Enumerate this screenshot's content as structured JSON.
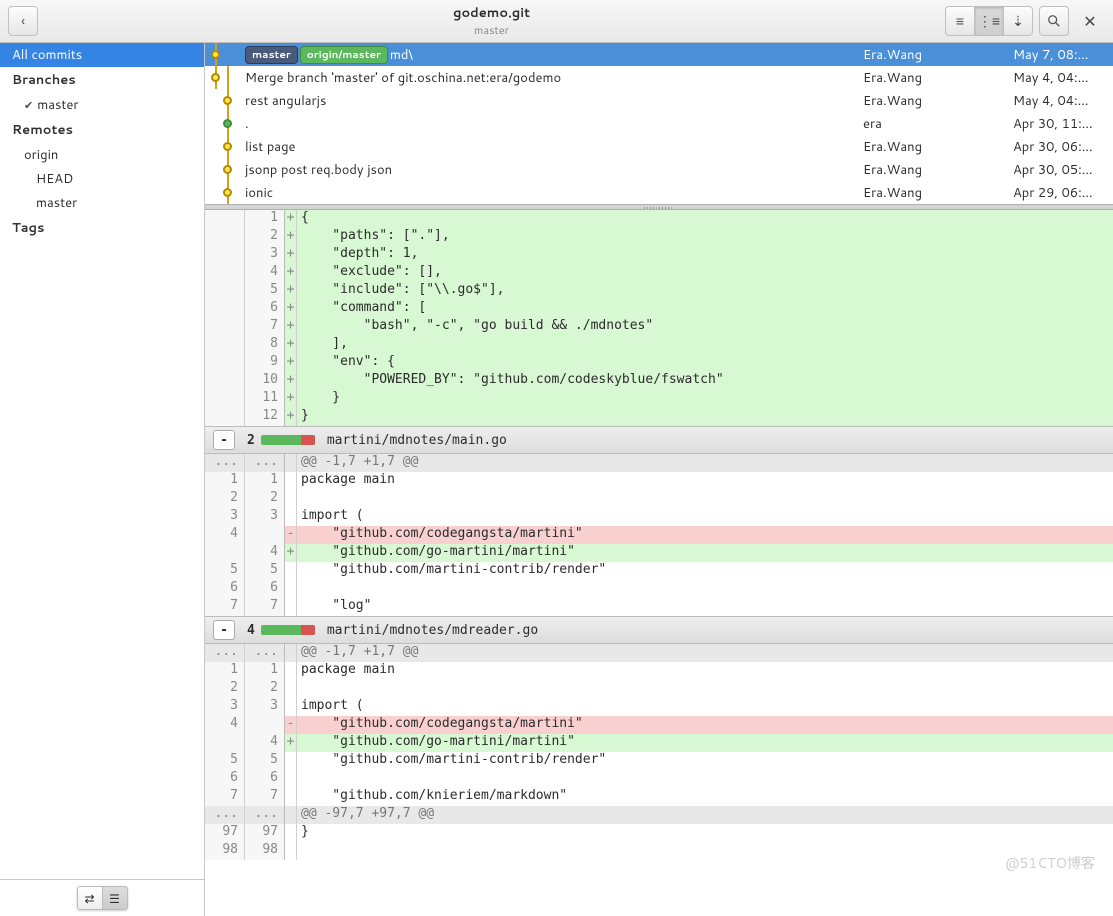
{
  "toolbar": {
    "title": "godemo.git",
    "subtitle": "master"
  },
  "sidebar": {
    "all_commits": "All commits",
    "branches_h": "Branches",
    "branch_master": "master",
    "remotes_h": "Remotes",
    "remote_origin": "origin",
    "remote_head": "HEAD",
    "remote_master": "master",
    "tags_h": "Tags"
  },
  "badges": {
    "master": "master",
    "origin": "origin/master"
  },
  "commits": [
    {
      "subj": "md\\",
      "auth": "Era.Wang",
      "dt": "May  7, 08:…",
      "sel": true,
      "d": 0,
      "badges": true
    },
    {
      "subj": "Merge branch 'master' of git.oschina.net:era/godemo",
      "auth": "Era.Wang",
      "dt": "May  4, 04:…",
      "d": 0
    },
    {
      "subj": "rest angularjs",
      "auth": "Era.Wang",
      "dt": "May  4, 04:…",
      "d": 1
    },
    {
      "subj": ".",
      "auth": "era",
      "dt": "Apr 30, 11:…",
      "d": 1,
      "green": true
    },
    {
      "subj": "list page",
      "auth": "Era.Wang",
      "dt": "Apr 30, 06:…",
      "d": 1
    },
    {
      "subj": "jsonp post req.body json",
      "auth": "Era.Wang",
      "dt": "Apr 30, 05:…",
      "d": 1
    },
    {
      "subj": "ionic",
      "auth": "Era.Wang",
      "dt": "Apr 29, 06:…",
      "d": 1
    }
  ],
  "diff": {
    "file1_lines": [
      {
        "r": "1",
        "s": "+",
        "c": "{",
        "t": "add"
      },
      {
        "r": "2",
        "s": "+",
        "c": "    \"paths\": [\".\"],",
        "t": "add"
      },
      {
        "r": "3",
        "s": "+",
        "c": "    \"depth\": 1,",
        "t": "add"
      },
      {
        "r": "4",
        "s": "+",
        "c": "    \"exclude\": [],",
        "t": "add"
      },
      {
        "r": "5",
        "s": "+",
        "c": "    \"include\": [\"\\\\.go$\"],",
        "t": "add"
      },
      {
        "r": "6",
        "s": "+",
        "c": "    \"command\": [",
        "t": "add"
      },
      {
        "r": "7",
        "s": "+",
        "c": "        \"bash\", \"-c\", \"go build && ./mdnotes\"",
        "t": "add"
      },
      {
        "r": "8",
        "s": "+",
        "c": "    ],",
        "t": "add"
      },
      {
        "r": "9",
        "s": "+",
        "c": "    \"env\": {",
        "t": "add"
      },
      {
        "r": "10",
        "s": "+",
        "c": "        \"POWERED_BY\": \"github.com/codeskyblue/fswatch\"",
        "t": "add"
      },
      {
        "r": "11",
        "s": "+",
        "c": "    }",
        "t": "add"
      },
      {
        "r": "12",
        "s": "+",
        "c": "}",
        "t": "add"
      }
    ],
    "file2": {
      "count": "2",
      "path": "martini/mdnotes/main.go",
      "hunk": "@@ -1,7 +1,7 @@"
    },
    "file2_lines": [
      {
        "l": "1",
        "r": "1",
        "c": "package main"
      },
      {
        "l": "2",
        "r": "2",
        "c": ""
      },
      {
        "l": "3",
        "r": "3",
        "c": "import ("
      },
      {
        "l": "4",
        "s": "-",
        "c": "    \"github.com/codegangsta/martini\"",
        "t": "del"
      },
      {
        "r": "4",
        "s": "+",
        "c": "    \"github.com/go-martini/martini\"",
        "t": "add"
      },
      {
        "l": "5",
        "r": "5",
        "c": "    \"github.com/martini-contrib/render\""
      },
      {
        "l": "6",
        "r": "6",
        "c": ""
      },
      {
        "l": "7",
        "r": "7",
        "c": "    \"log\""
      }
    ],
    "file3": {
      "count": "4",
      "path": "martini/mdnotes/mdreader.go",
      "hunk": "@@ -1,7 +1,7 @@"
    },
    "file3_lines": [
      {
        "l": "1",
        "r": "1",
        "c": "package main"
      },
      {
        "l": "2",
        "r": "2",
        "c": ""
      },
      {
        "l": "3",
        "r": "3",
        "c": "import ("
      },
      {
        "l": "4",
        "s": "-",
        "c": "    \"github.com/codegangsta/martini\"",
        "t": "del"
      },
      {
        "r": "4",
        "s": "+",
        "c": "    \"github.com/go-martini/martini\"",
        "t": "add"
      },
      {
        "l": "5",
        "r": "5",
        "c": "    \"github.com/martini-contrib/render\""
      },
      {
        "l": "6",
        "r": "6",
        "c": ""
      },
      {
        "l": "7",
        "r": "7",
        "c": "    \"github.com/knieriem/markdown\""
      }
    ],
    "file3_hunk2": "@@ -97,7 +97,7 @@",
    "file3_lines2": [
      {
        "l": "97",
        "r": "97",
        "c": "}"
      },
      {
        "l": "98",
        "r": "98",
        "c": ""
      }
    ]
  },
  "watermark": "@51CTO博客"
}
